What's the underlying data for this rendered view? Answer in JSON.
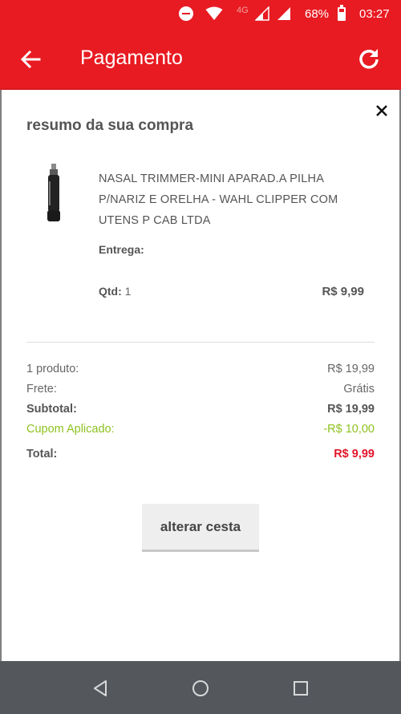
{
  "status_bar": {
    "network": "4G",
    "battery": "68%",
    "time": "03:27"
  },
  "app_bar": {
    "title": "Pagamento"
  },
  "summary_card": {
    "title": "resumo da sua compra",
    "product": {
      "name": "NASAL TRIMMER-MINI APARAD.A PILHA P/NARIZ E ORELHA - WAHL CLIPPER COM UTENS P CAB LTDA",
      "delivery_label": "Entrega:",
      "qty_label": "Qtd:",
      "qty_value": "1",
      "price": "R$ 9,99"
    },
    "totals": [
      {
        "label": "1 produto:",
        "value": "R$ 19,99"
      },
      {
        "label": "Frete:",
        "value": "Grátis"
      },
      {
        "label": "Subtotal:",
        "value": "R$ 19,99"
      },
      {
        "label": "Cupom Aplicado:",
        "value": "-R$ 10,00"
      },
      {
        "label": "Total:",
        "value": "R$ 9,99"
      }
    ],
    "change_button": "alterar cesta"
  },
  "colors": {
    "brand_red": "#e81b22",
    "coupon_green": "#8dc21f",
    "total_red": "#e2162a"
  },
  "icons": {
    "back": "arrow-left-icon",
    "refresh": "refresh-icon",
    "close": "close-icon"
  }
}
